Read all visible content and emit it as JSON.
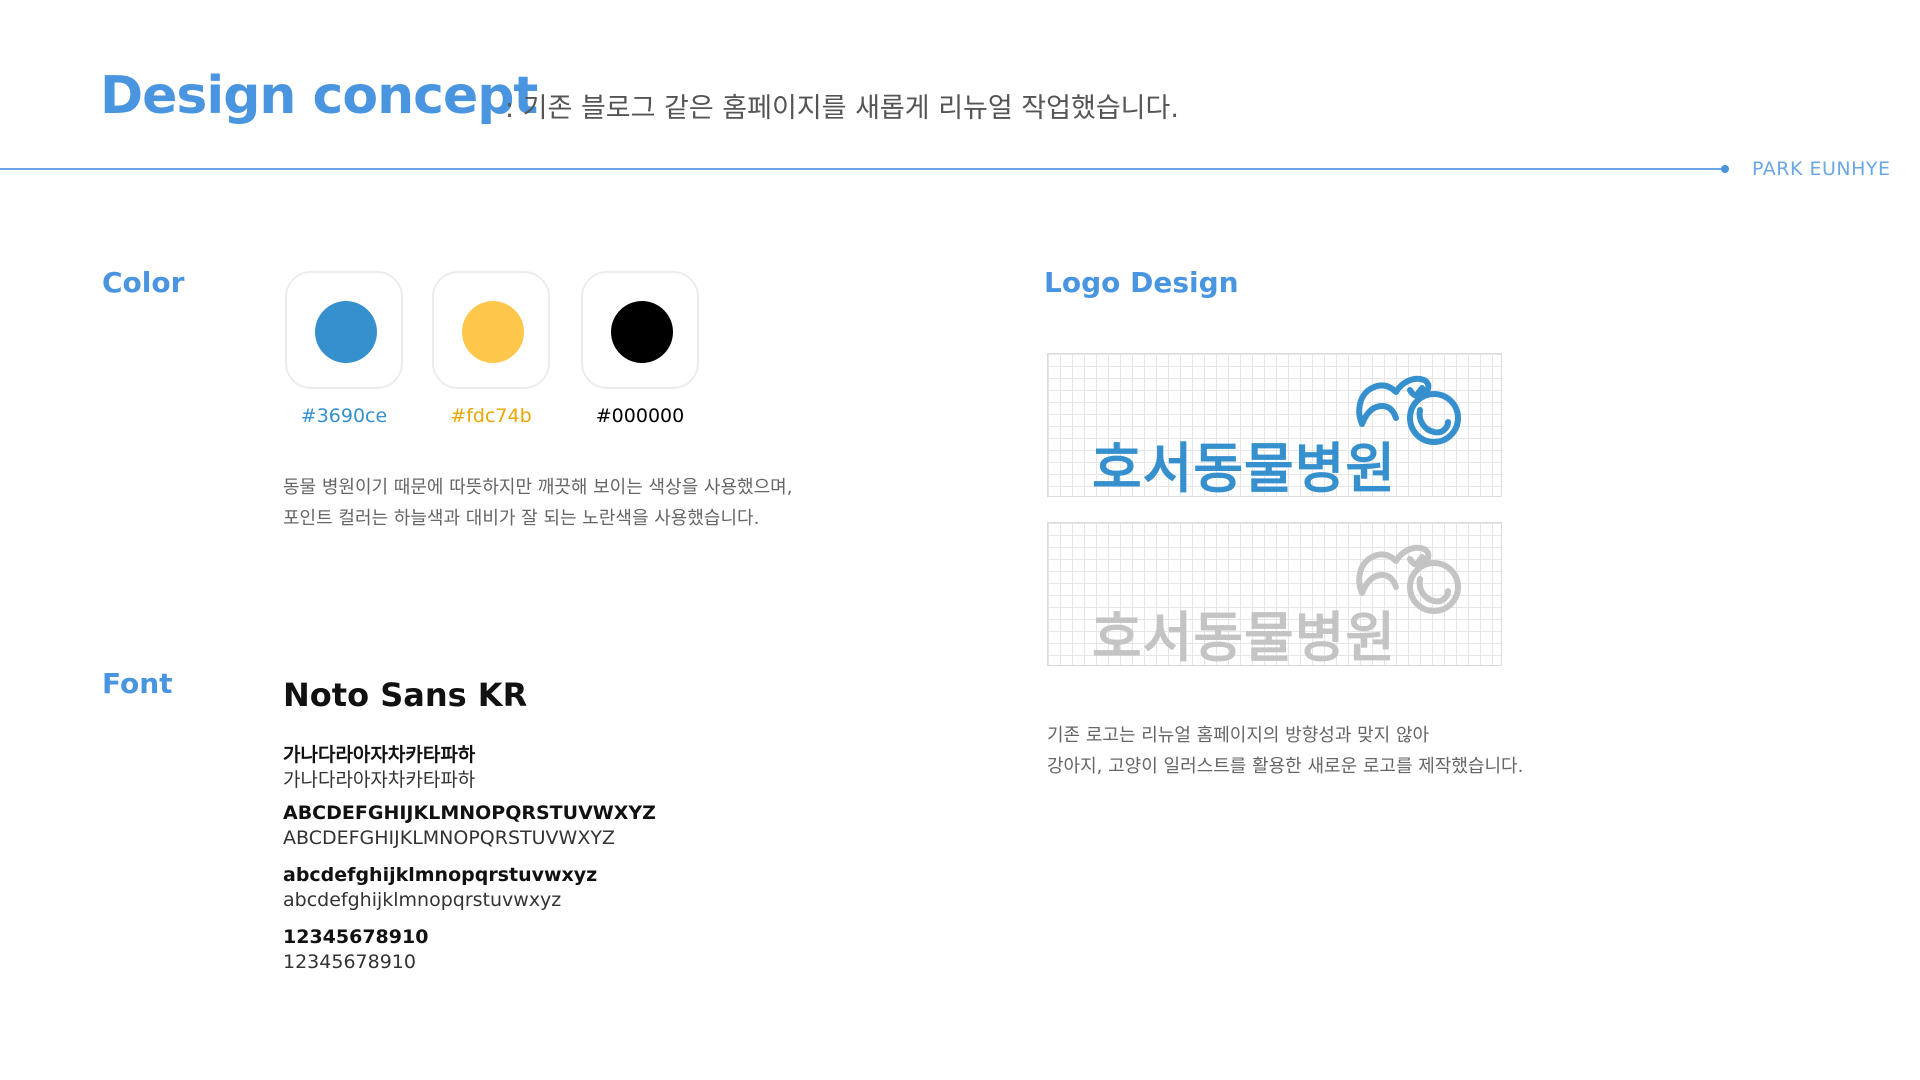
{
  "header": {
    "title": "Design concept",
    "subtitle": ":  기존 블로그 같은 홈페이지를 새롭게 리뉴얼 작업했습니다.",
    "author": "PARK EUNHYE"
  },
  "color_section": {
    "heading": "Color",
    "swatches": [
      {
        "label": "#3690ce",
        "color": "#3690ce",
        "label_color": "#3690ce"
      },
      {
        "label": "#fdc74b",
        "color": "#fdc74b",
        "label_color": "#e8a800"
      },
      {
        "label": "#000000",
        "color": "#000000",
        "label_color": "#000000"
      }
    ],
    "description": [
      "동물 병원이기 때문에 따뜻하지만 깨끗해 보이는 색상을 사용했으며,",
      "포인트 컬러는 하늘색과 대비가 잘 되는 노란색을 사용했습니다."
    ]
  },
  "font_section": {
    "heading": "Font",
    "font_name": "Noto Sans KR",
    "samples": [
      {
        "bold": "가나다라아자차카타파하",
        "regular": "가나다라아자차카타파하"
      },
      {
        "bold": "ABCDEFGHIJKLMNOPQRSTUVWXYZ",
        "regular": "ABCDEFGHIJKLMNOPQRSTUVWXYZ"
      },
      {
        "bold": "abcdefghijklmnopqrstuvwxyz",
        "regular": "abcdefghijklmnopqrstuvwxyz"
      },
      {
        "bold": "12345678910",
        "regular": "12345678910"
      }
    ]
  },
  "logo_section": {
    "heading": "Logo Design",
    "logos": [
      {
        "text": "호서동물병원",
        "color": "#3690ce",
        "icon": "dog-cat-outline-icon"
      },
      {
        "text": "호서동물병원",
        "color": "#c4c4c4",
        "icon": "dog-cat-outline-icon"
      }
    ],
    "description": [
      "기존 로고는 리뉴얼 홈페이지의 방향성과 맞지 않아",
      "강아지, 고양이 일러스트를 활용한 새로운 로고를 제작했습니다."
    ]
  }
}
